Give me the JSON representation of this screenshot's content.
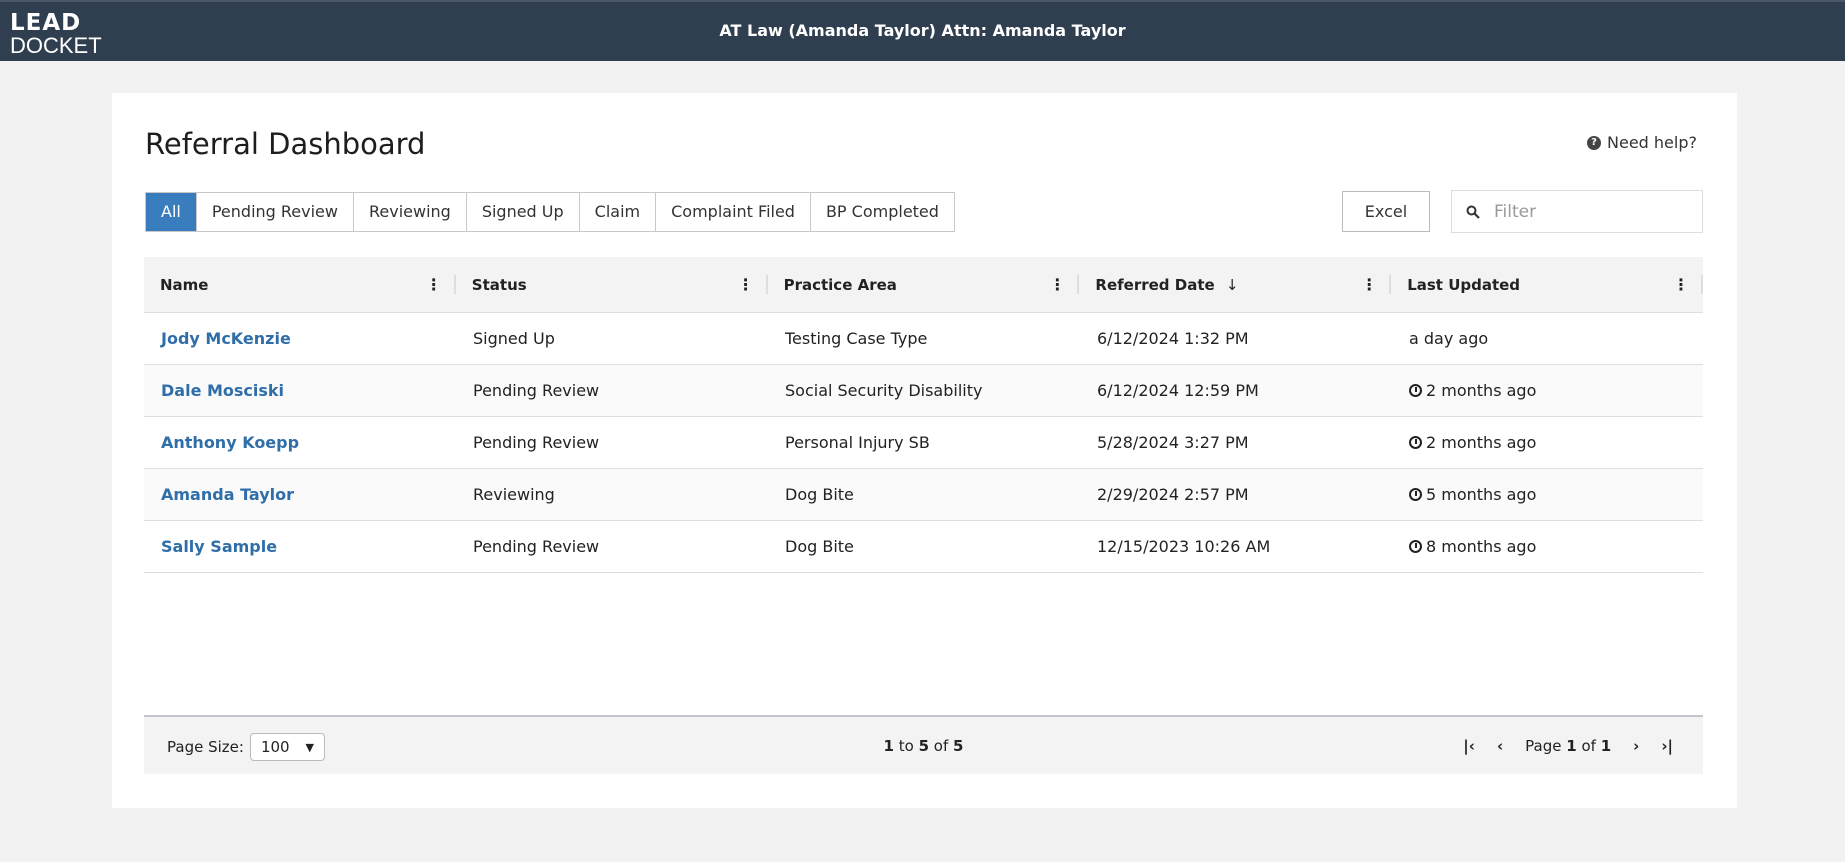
{
  "header": {
    "logo_line1": "LEAD",
    "logo_line2": "DOCKET",
    "title": "AT Law (Amanda Taylor) Attn: Amanda Taylor"
  },
  "page": {
    "title": "Referral Dashboard",
    "help": "Need help?"
  },
  "tabs": [
    {
      "label": "All",
      "active": true
    },
    {
      "label": "Pending Review"
    },
    {
      "label": "Reviewing"
    },
    {
      "label": "Signed Up"
    },
    {
      "label": "Claim"
    },
    {
      "label": "Complaint Filed"
    },
    {
      "label": "BP Completed"
    }
  ],
  "toolbar": {
    "excel": "Excel",
    "filter_placeholder": "Filter",
    "filter_value": ""
  },
  "grid": {
    "columns": [
      "Name",
      "Status",
      "Practice Area",
      "Referred Date",
      "Last Updated"
    ],
    "sort_indicator": "↓",
    "rows": [
      {
        "name": "Jody McKenzie",
        "status": "Signed Up",
        "area": "Testing Case Type",
        "date": "6/12/2024 1:32 PM",
        "updated": "a day ago",
        "warn": false
      },
      {
        "name": "Dale Mosciski",
        "status": "Pending Review",
        "area": "Social Security Disability",
        "date": "6/12/2024 12:59 PM",
        "updated": "2 months ago",
        "warn": true
      },
      {
        "name": "Anthony Koepp",
        "status": "Pending Review",
        "area": "Personal Injury SB",
        "date": "5/28/2024 3:27 PM",
        "updated": "2 months ago",
        "warn": true
      },
      {
        "name": "Amanda Taylor",
        "status": "Reviewing",
        "area": "Dog Bite",
        "date": "2/29/2024 2:57 PM",
        "updated": "5 months ago",
        "warn": true
      },
      {
        "name": "Sally Sample",
        "status": "Pending Review",
        "area": "Dog Bite",
        "date": "12/15/2023 10:26 AM",
        "updated": "8 months ago",
        "warn": true
      }
    ]
  },
  "footer": {
    "page_size_label": "Page Size:",
    "page_size": "100",
    "from": "1",
    "to_word": "to",
    "to": "5",
    "of_word": "of",
    "total": "5",
    "page_word": "Page",
    "page": "1",
    "pages": "1"
  },
  "colors": {
    "header": "#2f3f50",
    "accent": "#3a7dbf",
    "link": "#2f6ea8"
  }
}
